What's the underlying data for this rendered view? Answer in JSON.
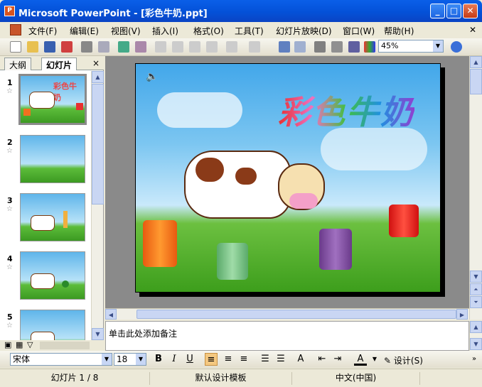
{
  "window": {
    "title": "Microsoft PowerPoint - [彩色牛奶.ppt]",
    "app_icon": "powerpoint-icon"
  },
  "menu": [
    "文件(F)",
    "编辑(E)",
    "视图(V)",
    "插入(I)",
    "格式(O)",
    "工具(T)",
    "幻灯片放映(D)",
    "窗口(W)",
    "帮助(H)"
  ],
  "toolbar": {
    "zoom": "45%"
  },
  "left_pane": {
    "tabs": [
      "大纲",
      "幻灯片"
    ],
    "close": "×",
    "slide_numbers": [
      "1",
      "2",
      "3",
      "4",
      "5"
    ]
  },
  "slide": {
    "title": "彩色牛奶"
  },
  "notes": {
    "placeholder": "单击此处添加备注"
  },
  "format_bar": {
    "font": "宋体",
    "size": "18",
    "bold": "B",
    "italic": "I",
    "underline": "U",
    "design": "设计(S)"
  },
  "status": {
    "slide": "幻灯片 1 / 8",
    "template": "默认设计模板",
    "language": "中文(中国)"
  },
  "colors": {
    "title_bar": "#0a5fe8",
    "accent_button": "#c73b16"
  }
}
